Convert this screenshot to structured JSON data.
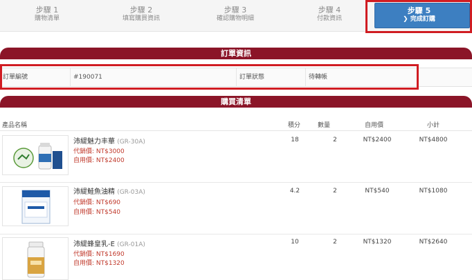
{
  "steps": [
    {
      "num": "步驟 1",
      "label": "購物清單"
    },
    {
      "num": "步驟 2",
      "label": "填寫購買資訊"
    },
    {
      "num": "步驟 3",
      "label": "確認購物明細"
    },
    {
      "num": "步驟 4",
      "label": "付款資訊"
    },
    {
      "num": "步驟 5",
      "label": "完成訂購",
      "arrow": "❯"
    }
  ],
  "order_section": {
    "title": "訂單資訊",
    "order_no_label": "訂單編號",
    "order_no_value": "#190071",
    "status_label": "訂單狀態",
    "status_value": "待轉帳"
  },
  "purchase_section": {
    "title": "購買清單",
    "headers": {
      "name": "產品名稱",
      "points": "積分",
      "qty": "數量",
      "self_price": "自用價",
      "subtotal": "小計"
    }
  },
  "products": [
    {
      "name": "沛緹魅力丰華",
      "code": "(GR-30A)",
      "agent_price": "代銷價: NT$3000",
      "self_price_line": "自用價: NT$2400",
      "points": "18",
      "qty": "2",
      "self_price": "NT$2400",
      "subtotal": "NT$4800"
    },
    {
      "name": "沛緹鮭魚油精",
      "code": "(GR-03A)",
      "agent_price": "代銷價: NT$690",
      "self_price_line": "自用價: NT$540",
      "points": "4.2",
      "qty": "2",
      "self_price": "NT$540",
      "subtotal": "NT$1080"
    },
    {
      "name": "沛緹蜂皇乳-E",
      "code": "(GR-01A)",
      "agent_price": "代銷價: NT$1690",
      "self_price_line": "自用價: NT$1320",
      "points": "10",
      "qty": "2",
      "self_price": "NT$1320",
      "subtotal": "NT$2640"
    }
  ],
  "colors": {
    "accent_blue": "#3d7fc1",
    "header_maroon": "#8b1528",
    "highlight_red": "#d01c22",
    "price_red": "#c0392b"
  }
}
